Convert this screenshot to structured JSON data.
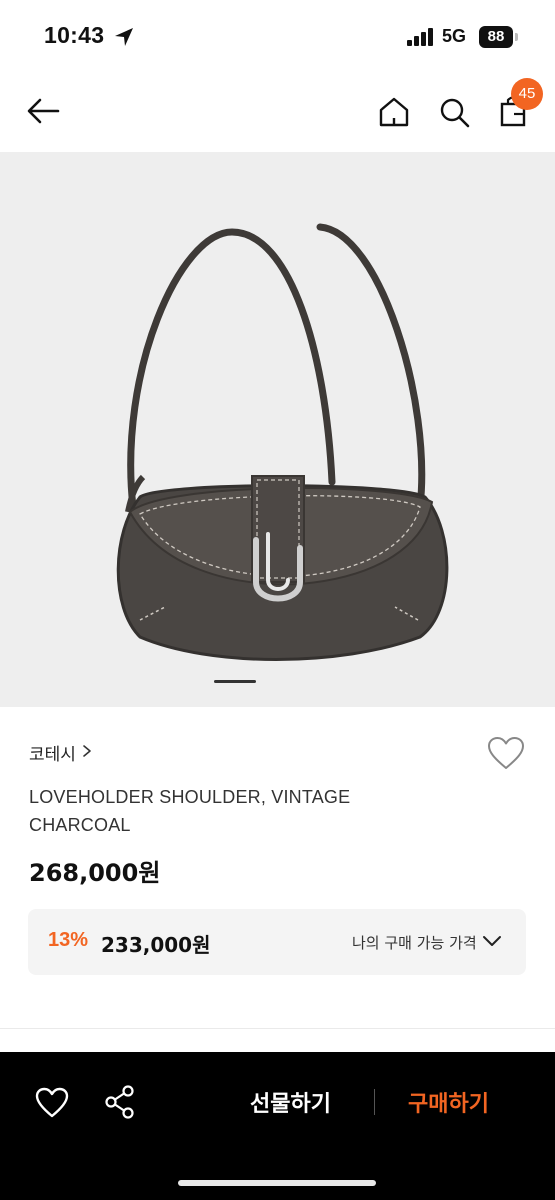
{
  "status_bar": {
    "time": "10:43",
    "network": "5G",
    "battery": "88"
  },
  "header": {
    "back_icon": "arrow-left-icon",
    "home_icon": "home-icon",
    "search_icon": "search-icon",
    "cart_icon": "shopping-bag-icon",
    "cart_count": "45"
  },
  "product": {
    "image_alt": "LOVEHOLDER SHOULDER, VINTAGE CHARCOAL",
    "brand": "코테시",
    "brand_chevron": "›",
    "name": "LOVEHOLDER SHOULDER, VINTAGE CHARCOAL",
    "price": "268,000원",
    "offer": {
      "discount_rate": "13%",
      "discount_price": "233,000원",
      "label": "나의 구매 가능 가격"
    }
  },
  "action_bar": {
    "gift_label": "선물하기",
    "buy_label": "구매하기"
  },
  "colors": {
    "accent": "#f26522",
    "bar_background": "#000000",
    "offer_background": "#f4f4f4"
  }
}
